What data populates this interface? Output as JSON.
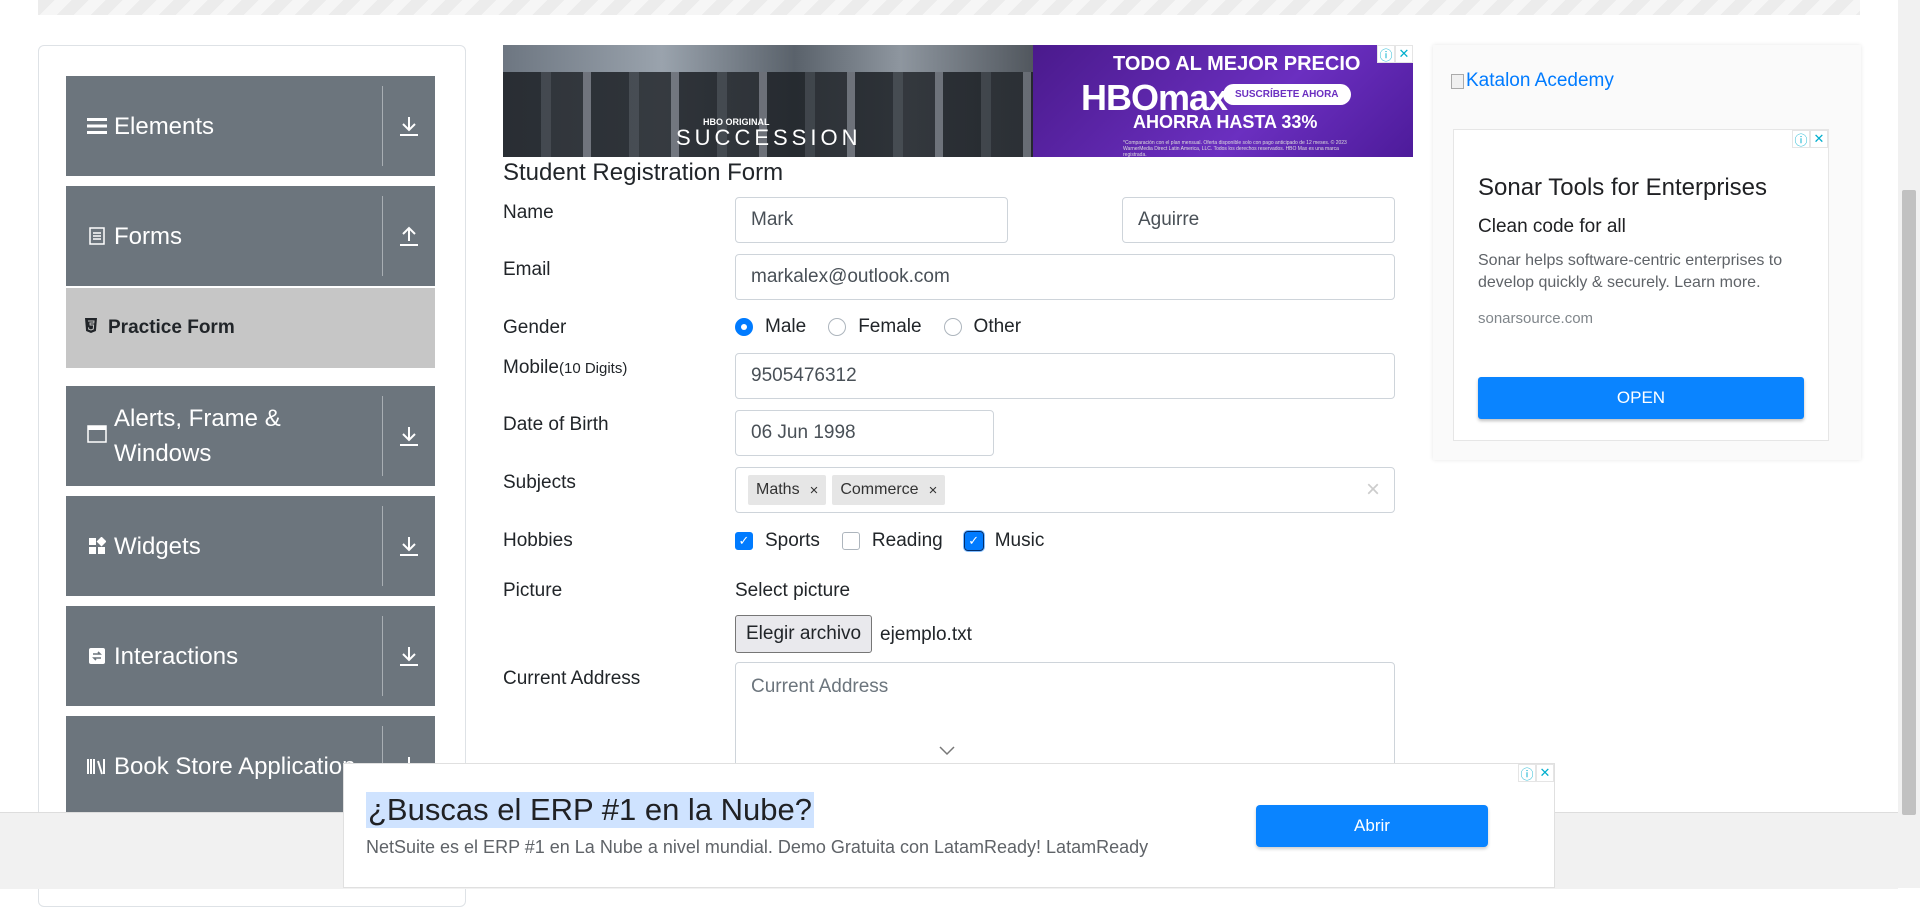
{
  "sidebar": {
    "groups": [
      {
        "label": "Elements",
        "icon": "menu-icon",
        "arrow": "download-icon"
      },
      {
        "label": "Forms",
        "icon": "document-icon",
        "arrow": "upload-icon"
      },
      {
        "label": "Alerts, Frame & Windows",
        "icon": "window-icon",
        "arrow": "download-icon"
      },
      {
        "label": "Widgets",
        "icon": "widgets-icon",
        "arrow": "download-icon"
      },
      {
        "label": "Interactions",
        "icon": "interactions-icon",
        "arrow": "download-icon"
      },
      {
        "label": "Book Store Application",
        "icon": "books-icon",
        "arrow": "download-icon"
      }
    ],
    "active_item": {
      "label": "Practice Form",
      "icon": "html5-icon"
    }
  },
  "banner_ad": {
    "hbo_original": "HBO ORIGINAL",
    "show_title": "SUCCESSION",
    "headline": "TODO AL MEJOR PRECIO",
    "brand": "HBOmax",
    "subscribe": "SUSCRÍBETE AHORA",
    "savings": "AHORRA HASTA 33%",
    "fine_print": "*Comparación con el plan mensual. Oferta disponible solo con pago anticipado de 12 meses. © 2023 WarnerMedia Direct Latin America, LLC. Todos los derechos reservados. HBO Max es una marca registrada."
  },
  "form": {
    "title": "Student Registration Form",
    "name_label": "Name",
    "first_name": "Mark",
    "last_name": "Aguirre",
    "email_label": "Email",
    "email": "markalex@outlook.com",
    "gender_label": "Gender",
    "gender_options": [
      {
        "label": "Male",
        "selected": true
      },
      {
        "label": "Female",
        "selected": false
      },
      {
        "label": "Other",
        "selected": false
      }
    ],
    "mobile_label": "Mobile",
    "mobile_hint": "(10 Digits)",
    "mobile": "9505476312",
    "dob_label": "Date of Birth",
    "dob": "06 Jun 1998",
    "subjects_label": "Subjects",
    "subjects": [
      "Maths",
      "Commerce"
    ],
    "clear_symbol": "×",
    "chip_remove_symbol": "×",
    "hobbies_label": "Hobbies",
    "hobbies": [
      {
        "label": "Sports",
        "checked": true
      },
      {
        "label": "Reading",
        "checked": false
      },
      {
        "label": "Music",
        "checked": true
      }
    ],
    "check_mark": "✓",
    "picture_label": "Picture",
    "select_picture": "Select picture",
    "file_button": "Elegir archivo",
    "file_name": "ejemplo.txt",
    "address_label": "Current Address",
    "address_placeholder": "Current Address"
  },
  "side_ad": {
    "katalon": "Katalon Acedemy",
    "title": "Sonar Tools for Enterprises",
    "subtitle": "Clean code for all",
    "body": "Sonar helps software-centric enterprises to develop quickly & securely. Learn more.",
    "url": "sonarsource.com",
    "button": "OPEN"
  },
  "bottom_ad": {
    "headline": "¿Buscas el ERP #1 en la Nube?",
    "description": "NetSuite es el ERP #1 en La Nube a nivel mundial. Demo Gratuita con LatamReady! LatamReady",
    "button": "Abrir"
  },
  "ad_choices": {
    "info": "ⓘ",
    "close": "✕"
  }
}
